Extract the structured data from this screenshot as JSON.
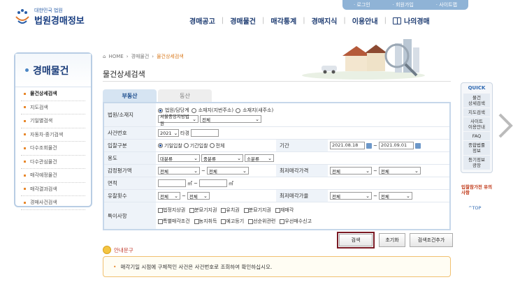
{
  "top_links": [
    "· 로그인",
    "· 회원가입",
    "· 사이트맵"
  ],
  "logo": {
    "sub": "대한민국 법원",
    "main": "법원경매정보"
  },
  "gnb": [
    "경매공고",
    "경매물건",
    "매각통계",
    "경매지식",
    "이용안내",
    "나의경매"
  ],
  "sidebar": {
    "title": "경매물건",
    "items": [
      "물건상세검색",
      "지도검색",
      "기일별검색",
      "자동차·중기검색",
      "다수조회물건",
      "다수관심물건",
      "매각예정물건",
      "매각결과검색",
      "경매사건검색"
    ]
  },
  "breadcrumb": [
    "HOME",
    "경매물건",
    "물건상세검색"
  ],
  "page_title": "물건상세검색",
  "tabs": [
    "부동산",
    "동산"
  ],
  "form": {
    "court_label": "법원/소재지",
    "court_options": [
      "법원/담당계",
      "소재지(지번주소)",
      "소재지(새주소)"
    ],
    "court_select": "서울중앙지방법원",
    "court_dept": "전체",
    "case_label": "사건번호",
    "case_year": "2021",
    "case_suffix": "타경",
    "bid_label": "입찰구분",
    "bid_options": [
      "기일입찰",
      "기간입찰",
      "전체"
    ],
    "period_label": "기간",
    "date_from": "2021.08.18",
    "date_to": "2021.09.01",
    "use_label": "용도",
    "use1": "대분류",
    "use2": "중분류",
    "use3": "소분류",
    "appraisal_label": "감정평가액",
    "sel_all": "전체",
    "minprice_label": "최저매각가격",
    "area_label": "면적",
    "area_unit": "㎡",
    "fail_label": "유찰횟수",
    "minrate_label": "최저매각가율",
    "special_label": "특이사항",
    "special_row1": [
      "법정지상권",
      "분묘기지권",
      "유치권",
      "분묘기지권",
      "재매각"
    ],
    "special_row2": [
      "특별매각조건",
      "농지취득",
      "예고등기",
      "선순위관련",
      "우선매수신고"
    ]
  },
  "buttons": {
    "search": "검색",
    "reset": "초기화",
    "add": "검색조건추가"
  },
  "guide": {
    "head": "안내문구",
    "text": "매각기일 시점에 구체적인 사건은 사건번호로 조회하여 확인하십시오."
  },
  "quick": {
    "title": "QUICK",
    "items": [
      "물건\n상세검색",
      "지도검색",
      "사이트\n이용안내",
      "FAQ",
      "종합법률\n정보",
      "등기정보\n광장"
    ]
  },
  "notice": "입찰참가전 유의사항",
  "top_btn": "^TOP"
}
